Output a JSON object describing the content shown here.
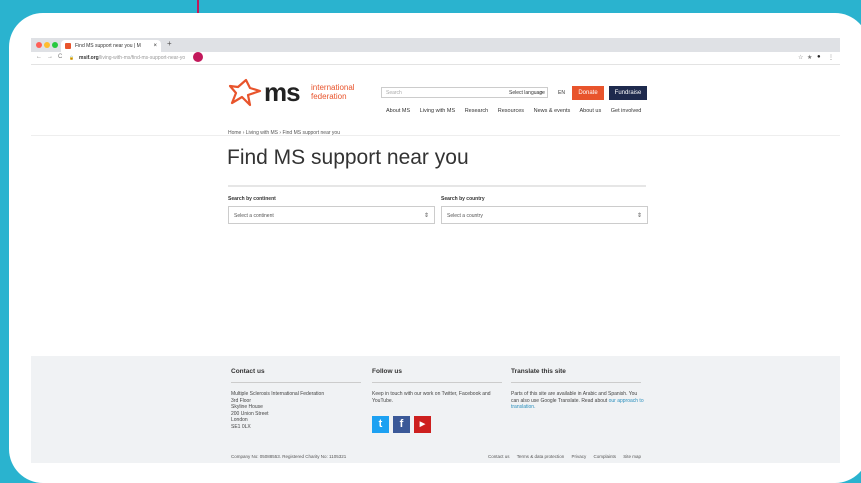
{
  "browser": {
    "tab_title": "Find MS support near you | M",
    "tab_close": "×",
    "new_tab": "+",
    "url_domain": "msif.org",
    "url_path": "/living-with-ms/find-ms-support-near-yo",
    "nav_back": "←",
    "nav_forward": "→",
    "nav_reload": "C",
    "lock": "🔒",
    "extensions": [
      "☆",
      "★",
      "●",
      "⋮"
    ],
    "traffic_colors": [
      "#ff5f57",
      "#ffbd2e",
      "#28c940"
    ]
  },
  "header": {
    "logo_ms": "ms",
    "logo_international": "international",
    "logo_federation": "federation",
    "search_placeholder": "Search",
    "search_icon": "⌕",
    "select_language": "Select language",
    "language_code": "EN",
    "donate": "Donate",
    "fundraise": "Fundraise",
    "nav": [
      "About MS",
      "Living with MS",
      "Research",
      "Resources",
      "News & events",
      "About us",
      "Get involved"
    ],
    "colors": {
      "brand_orange": "#e8542c",
      "brand_navy": "#1e2a4d"
    }
  },
  "main": {
    "breadcrumb": "Home  ›  Living with MS  ›  Find MS support near you",
    "title": "Find MS support near you",
    "continent_label": "Search by continent",
    "continent_placeholder": "Select a continent",
    "country_label": "Search by country",
    "country_placeholder": "Select a country",
    "dropdown_arrow": "⇕"
  },
  "footer": {
    "contact_heading": "Contact us",
    "contact_lines": [
      "Multiple Sclerosis International Federation",
      "3rd Floor",
      "Skyline House",
      "200 Union Street",
      "London",
      "SE1 0LX"
    ],
    "follow_heading": "Follow us",
    "follow_text": "Keep in touch with our work on Twitter, Facebook and YouTube.",
    "social": {
      "twitter": "t",
      "facebook": "f",
      "youtube": "▶"
    },
    "social_colors": {
      "twitter": "#1da1f2",
      "facebook": "#3b5998",
      "youtube": "#cd201f"
    },
    "translate_heading": "Translate this site",
    "translate_text": "Parts of this site are available in Arabic and Spanish. You can also use Google Translate. Read about",
    "translate_link": "our approach to translation.",
    "company": "Company No: 05088553. Registered Charity No: 1105321",
    "bottom_links": [
      "Contact us",
      "Terms & data protection",
      "Privacy",
      "Complaints",
      "Site map"
    ]
  },
  "annotation": {
    "color": "#c2185b"
  }
}
